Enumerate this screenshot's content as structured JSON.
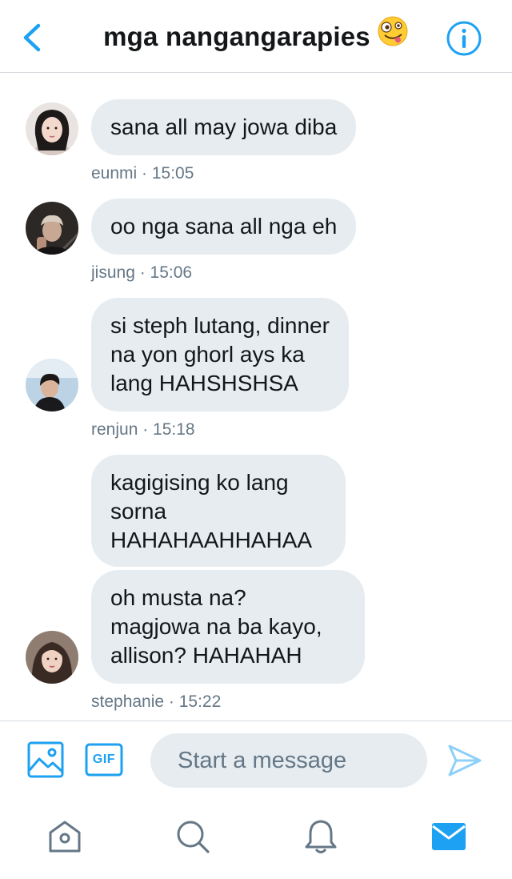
{
  "header": {
    "title": "mga nangangarapies",
    "title_emoji_icon": "zany-face-emoji-icon",
    "back_icon": "chevron-left-icon",
    "info_icon": "info-circle-icon"
  },
  "messages": [
    {
      "text": "sana all may jowa diba",
      "sender": "eunmi",
      "time": "15:05"
    },
    {
      "text": "oo nga sana all nga eh",
      "sender": "jisung",
      "time": "15:06"
    },
    {
      "text": "si steph lutang, dinner\nna yon ghorl ays ka\nlang HAHSHSHSA",
      "sender": "renjun",
      "time": "15:18"
    },
    {
      "text": "kagigising ko lang\nsorna\nHAHAHAAHHAHAA",
      "sender": "stephanie",
      "time": ""
    },
    {
      "text": "oh musta na?\nmagjowa na ba kayo,\nallison? HAHAHAH",
      "sender": "stephanie",
      "time": "15:22"
    }
  ],
  "meta_lines": [
    "eunmi · 15:05",
    "jisung · 15:06",
    "renjun · 15:18",
    "stephanie · 15:22"
  ],
  "composer": {
    "placeholder": "Start a message",
    "value": "",
    "image_icon": "image-icon",
    "gif_label": "GIF",
    "send_icon": "send-icon"
  },
  "tabs": [
    {
      "name": "home",
      "icon": "home-icon",
      "active": false
    },
    {
      "name": "search",
      "icon": "search-icon",
      "active": false
    },
    {
      "name": "notifications",
      "icon": "bell-icon",
      "active": false
    },
    {
      "name": "messages",
      "icon": "envelope-icon",
      "active": true
    }
  ],
  "colors": {
    "accent": "#1da1f2",
    "bubble": "#e6ecf0",
    "meta_text": "#657786",
    "icon_gray": "#657786"
  }
}
